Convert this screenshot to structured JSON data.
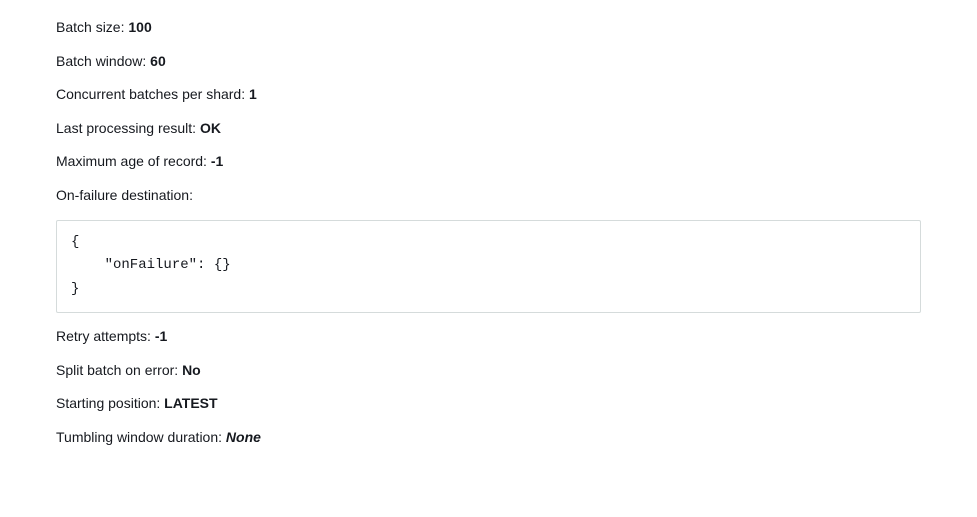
{
  "fields": {
    "batch_size": {
      "label": "Batch size: ",
      "value": "100"
    },
    "batch_window": {
      "label": "Batch window: ",
      "value": "60"
    },
    "concurrent_batches": {
      "label": "Concurrent batches per shard: ",
      "value": "1"
    },
    "last_result": {
      "label": "Last processing result: ",
      "value": "OK"
    },
    "max_age": {
      "label": "Maximum age of record: ",
      "value": "-1"
    },
    "on_failure": {
      "label": "On-failure destination:"
    },
    "retry_attempts": {
      "label": "Retry attempts: ",
      "value": "-1"
    },
    "split_batch": {
      "label": "Split batch on error: ",
      "value": "No"
    },
    "starting_position": {
      "label": "Starting position: ",
      "value": "LATEST"
    },
    "tumbling_window": {
      "label": "Tumbling window duration: ",
      "value": "None"
    }
  },
  "on_failure_code": "{\n    \"onFailure\": {}\n}"
}
